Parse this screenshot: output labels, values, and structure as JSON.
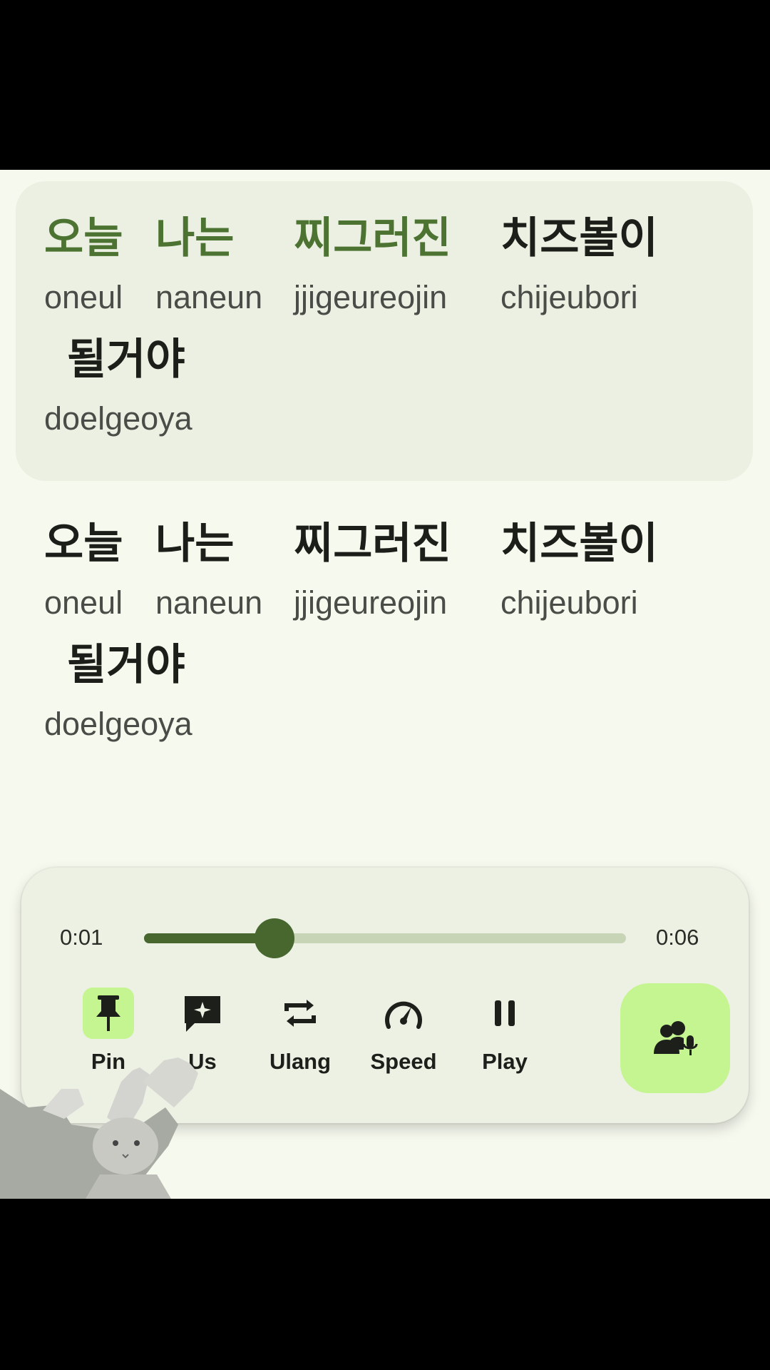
{
  "lyrics": {
    "current_line": {
      "words": [
        {
          "hangul": "오늘",
          "roman": "oneul",
          "active": true
        },
        {
          "hangul": "나는",
          "roman": "naneun",
          "active": true
        },
        {
          "hangul": "찌그러진",
          "roman": "jjigeureojin",
          "active": true
        },
        {
          "hangul": "치즈볼이",
          "roman": "chijeubori",
          "active": false
        },
        {
          "hangul": "될거야",
          "roman": "doelgeoya",
          "active": false
        }
      ]
    },
    "next_line": {
      "words": [
        {
          "hangul": "오늘",
          "roman": "oneul"
        },
        {
          "hangul": "나는",
          "roman": "naneun"
        },
        {
          "hangul": "찌그러진",
          "roman": "jjigeureojin"
        },
        {
          "hangul": "치즈볼이",
          "roman": "chijeubori"
        },
        {
          "hangul": "될거야",
          "roman": "doelgeoya"
        }
      ]
    }
  },
  "player": {
    "elapsed": "0:01",
    "total": "0:06",
    "progress": 0.27,
    "controls": [
      {
        "label": "Pin",
        "icon": "pin-icon",
        "active": true
      },
      {
        "label": "Us",
        "icon": "sparkle-message-icon",
        "active": false
      },
      {
        "label": "Ulang",
        "icon": "repeat-icon",
        "active": false
      },
      {
        "label": "Speed",
        "icon": "speedometer-icon",
        "active": false
      },
      {
        "label": "Play",
        "icon": "pause-icon",
        "active": false
      }
    ],
    "fab_icon": "duet-mic-icon"
  },
  "colors": {
    "accent": "#4d7332",
    "accent_light": "#c5f590",
    "background": "#f6f9ee",
    "card": "#ebf0e3"
  }
}
